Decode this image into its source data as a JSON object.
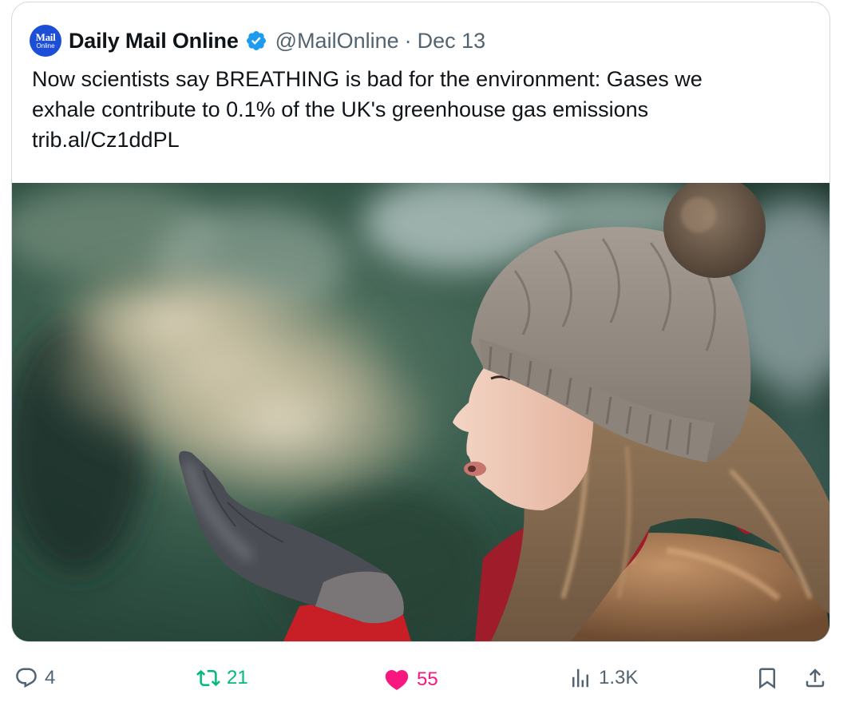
{
  "tweet": {
    "avatar": {
      "top": "Mail",
      "bottom": "Online"
    },
    "author_name": "Daily Mail Online",
    "handle": "@MailOnline",
    "separator": "·",
    "date": "Dec 13",
    "text_lines": [
      "Now scientists say BREATHING is bad for the environment: Gases we",
      "exhale contribute to 0.1% of the UK's greenhouse gas emissions",
      "trib.al/Cz1ddPL"
    ]
  },
  "actions": {
    "reply_count": "4",
    "retweet_count": "21",
    "like_count": "55",
    "views_count": "1.3K"
  },
  "icons": {
    "verified": "verified-badge-icon",
    "reply": "reply-icon",
    "retweet": "retweet-icon",
    "like": "heart-icon",
    "views": "views-icon",
    "bookmark": "bookmark-icon",
    "share": "share-icon"
  },
  "colors": {
    "verified": "#1d9bf0",
    "retweet_active": "#00ba7c",
    "like_active": "#f91880",
    "muted": "#536471",
    "text": "#0f1419",
    "border": "#cfd9de",
    "avatar_bg": "#1d4ed8"
  }
}
